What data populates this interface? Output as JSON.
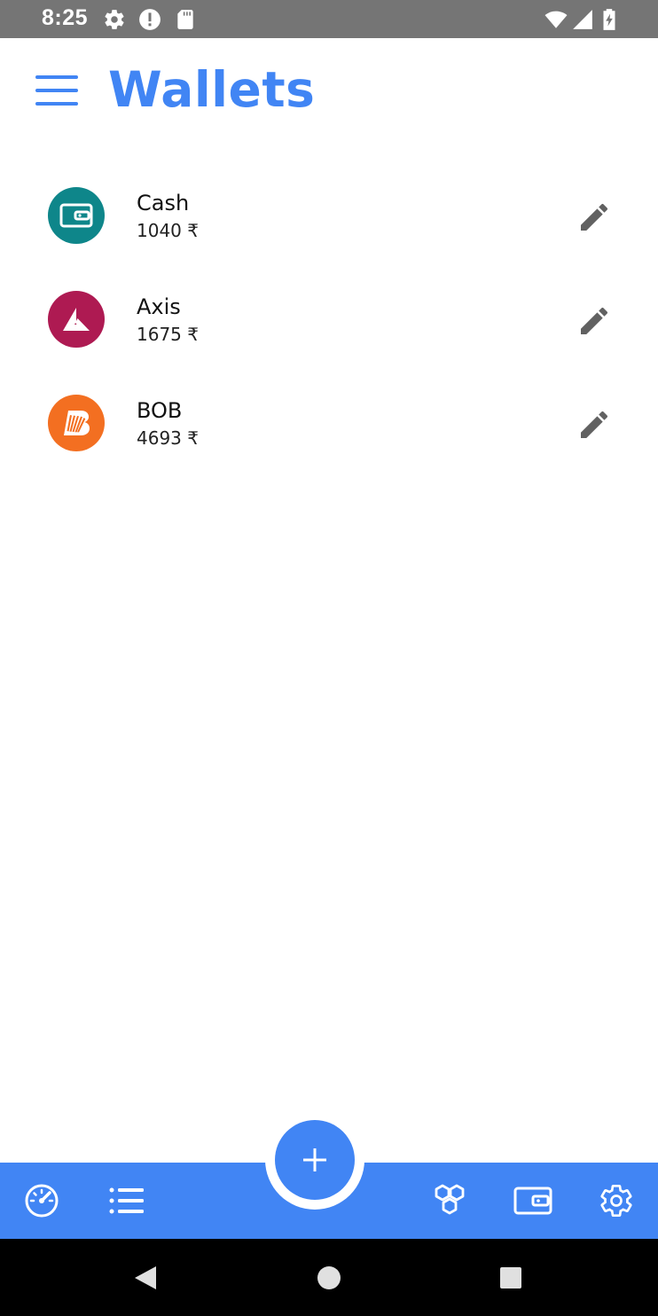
{
  "status_bar": {
    "time": "8:25",
    "icons": [
      "settings-icon",
      "alert-icon",
      "sd-card-icon",
      "wifi-icon",
      "signal-icon",
      "battery-charging-icon"
    ]
  },
  "header": {
    "title": "Wallets",
    "menu_icon": "hamburger-menu-icon"
  },
  "wallets": [
    {
      "name": "Cash",
      "balance": "1040 ₹",
      "icon": "wallet-icon",
      "color": "#0e868a"
    },
    {
      "name": "Axis",
      "balance": "1675 ₹",
      "icon": "axis-bank-logo-icon",
      "color": "#ae1a52"
    },
    {
      "name": "BOB",
      "balance": "4693 ₹",
      "icon": "bob-bank-logo-icon",
      "color": "#f36f21"
    }
  ],
  "bottom_nav": {
    "items": [
      "dashboard-speedometer-icon",
      "transactions-list-icon",
      "categories-icon",
      "wallets-icon",
      "settings-icon"
    ],
    "fab_icon": "plus-icon"
  },
  "theme": {
    "primary": "#4185f4",
    "status_bar": "#757575",
    "edit_icon": "#616161"
  },
  "system_nav": [
    "back-icon",
    "home-icon",
    "recents-icon"
  ]
}
